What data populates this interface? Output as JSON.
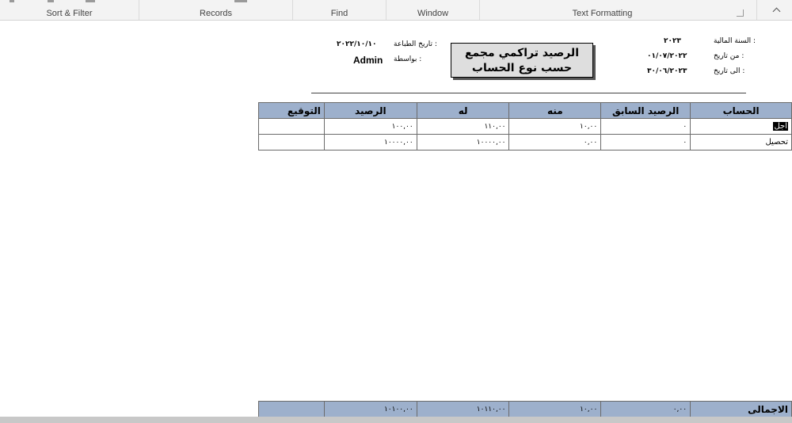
{
  "ribbon": {
    "groups": [
      {
        "label": "Sort & Filter"
      },
      {
        "label": "Records"
      },
      {
        "label": "Find"
      },
      {
        "label": "Window"
      },
      {
        "label": "Text Formatting"
      }
    ]
  },
  "report": {
    "title": "الرصيد تراكمي مجمع حسب نوع الحساب",
    "fiscal_year_label": "السنة المالية :",
    "fiscal_year_value": "٢٠٢٣",
    "from_date_label": "من تاريخ :",
    "from_date_value": "٠١/٠٧/٢٠٢٢",
    "to_date_label": "الى تاريخ :",
    "to_date_value": "٣٠/٠٦/٢٠٢٣",
    "print_date_label": "تاريخ الطباعة :",
    "print_date_value": "٢٠٢٢/١٠/١٠",
    "by_label": "بواسطة :",
    "by_value": "Admin",
    "columns": {
      "account": "الحساب",
      "prev_balance": "الرصيد السابق",
      "debit": "منه",
      "credit": "له",
      "balance": "الرصيد",
      "signature": "التوقيع"
    },
    "rows": [
      {
        "account": "آجل",
        "prev_balance": "٠",
        "debit": "١٠,٠٠",
        "credit": "١١٠,٠٠",
        "balance": "١٠٠,٠٠",
        "signature": ""
      },
      {
        "account": "تحصيل",
        "prev_balance": "٠",
        "debit": "٠,٠٠",
        "credit": "١٠٠٠٠,٠٠",
        "balance": "١٠٠٠٠,٠٠",
        "signature": ""
      }
    ],
    "totals": {
      "label": "الاجمالى",
      "prev_balance": "٠,٠٠",
      "debit": "١٠,٠٠",
      "credit": "١٠١١٠,٠٠",
      "balance": "١٠١٠٠,٠٠",
      "signature": ""
    }
  }
}
